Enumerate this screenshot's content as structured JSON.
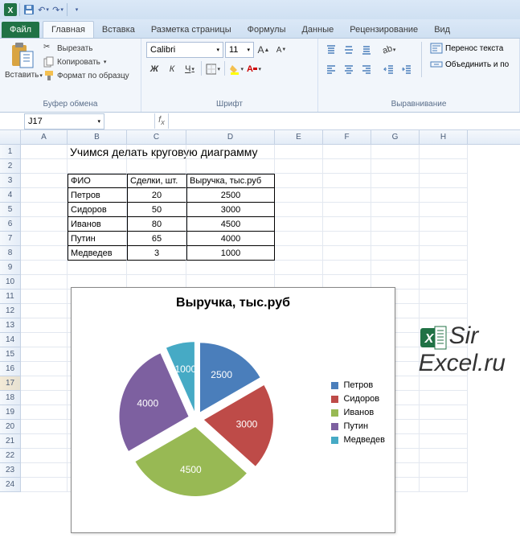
{
  "qat": {
    "save": "save-icon",
    "undo": "undo-icon",
    "redo": "redo-icon"
  },
  "tabs": {
    "file": "Файл",
    "items": [
      "Главная",
      "Вставка",
      "Разметка страницы",
      "Формулы",
      "Данные",
      "Рецензирование",
      "Вид"
    ],
    "active_index": 0
  },
  "ribbon": {
    "clipboard": {
      "paste": "Вставить",
      "cut": "Вырезать",
      "copy": "Копировать",
      "format_painter": "Формат по образцу",
      "group_label": "Буфер обмена"
    },
    "font": {
      "name": "Calibri",
      "size": "11",
      "group_label": "Шрифт"
    },
    "alignment": {
      "wrap_text": "Перенос текста",
      "merge": "Объединить и по",
      "group_label": "Выравнивание"
    }
  },
  "namebox": "J17",
  "sheet_title": "Учимся делать круговую диаграмму",
  "table": {
    "headers": [
      "ФИО",
      "Сделки, шт.",
      "Выручка, тыс.руб"
    ],
    "rows": [
      [
        "Петров",
        "20",
        "2500"
      ],
      [
        "Сидоров",
        "50",
        "3000"
      ],
      [
        "Иванов",
        "80",
        "4500"
      ],
      [
        "Путин",
        "65",
        "4000"
      ],
      [
        "Медведев",
        "3",
        "1000"
      ]
    ]
  },
  "watermark": {
    "line1": "Sir",
    "line2": "Excel.ru"
  },
  "chart_data": {
    "type": "pie",
    "title": "Выручка, тыс.руб",
    "categories": [
      "Петров",
      "Сидоров",
      "Иванов",
      "Путин",
      "Медведев"
    ],
    "values": [
      2500,
      3000,
      4500,
      4000,
      1000
    ],
    "colors": [
      "#4a7ebb",
      "#be4b48",
      "#98b954",
      "#7d60a0",
      "#46aac5"
    ]
  },
  "col_labels": [
    "A",
    "B",
    "C",
    "D",
    "E",
    "F",
    "G",
    "H"
  ],
  "row_count": 24
}
